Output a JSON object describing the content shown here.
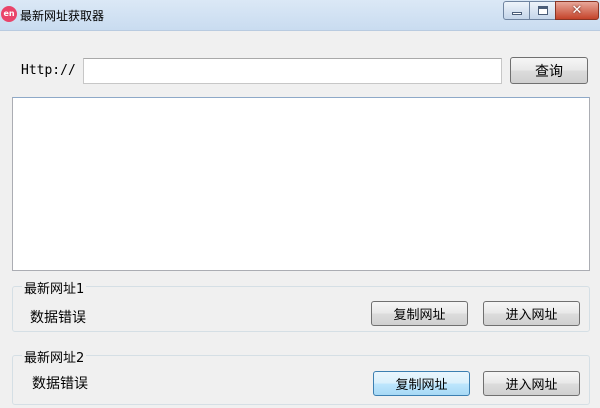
{
  "window": {
    "title": "最新网址获取器",
    "icon": "app-logo-icon",
    "icon_text": "en",
    "controls": {
      "close_symbol": "✕"
    }
  },
  "query": {
    "url_label": "Http://",
    "url_value": "",
    "button_label": "查询"
  },
  "result": {
    "text": ""
  },
  "groups": [
    {
      "legend": "最新网址1",
      "status": "数据错误",
      "copy_label": "复制网址",
      "enter_label": "进入网址"
    },
    {
      "legend": "最新网址2",
      "status": "数据错误",
      "copy_label": "复制网址",
      "enter_label": "进入网址"
    }
  ],
  "colors": {
    "title_bar": "#c9dcf0",
    "background": "#f0f0f0",
    "close_button": "#c4432a",
    "app_icon": "#e9446a"
  }
}
